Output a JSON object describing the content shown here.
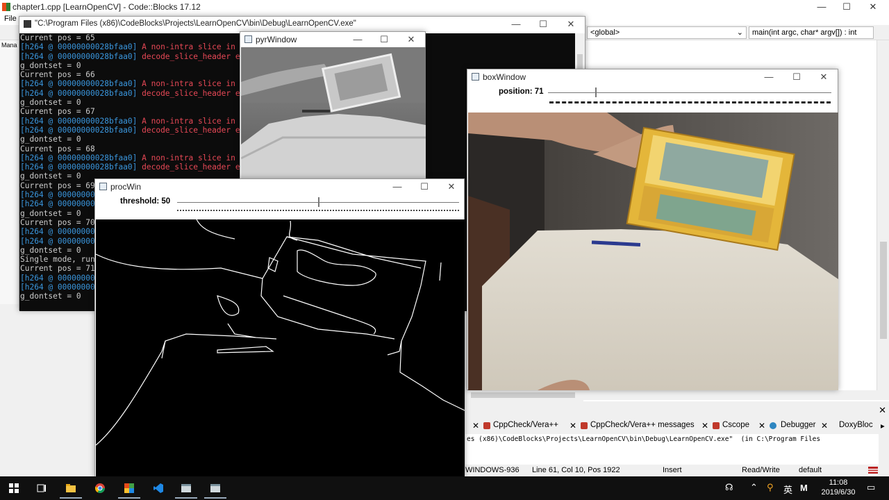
{
  "codeblocks": {
    "title": "chapter1.cpp [LearnOpenCV] - Code::Blocks 17.12",
    "menu_first": "File",
    "scope_combo": "<global>",
    "function_combo": "main(int argc, char* argv[]) : int",
    "left_panel_label": "Mana",
    "log_tabs": [
      {
        "label": "CppCheck/Vera++",
        "icon": "cppcheck-icon"
      },
      {
        "label": "CppCheck/Vera++ messages",
        "icon": "cppcheck-icon"
      },
      {
        "label": "Cscope",
        "icon": "cscope-icon"
      },
      {
        "label": "Debugger",
        "icon": "debugger-icon"
      },
      {
        "label": "DoxyBloc",
        "icon": "doxyblocks-icon"
      }
    ],
    "log_line": "es (x86)\\CodeBlocks\\Projects\\LearnOpenCV\\bin\\Debug\\LearnOpenCV.exe\"  (in C:\\Program Files",
    "status": {
      "encoding": "WINDOWS-936",
      "position": "Line 61, Col 10, Pos 1922",
      "mode": "Insert",
      "access": "Read/Write",
      "profile": "default"
    }
  },
  "console": {
    "title": "\"C:\\Program Files (x86)\\CodeBlocks\\Projects\\LearnOpenCV\\bin\\Debug\\LearnOpenCV.exe\"",
    "lines": [
      {
        "parts": [
          {
            "c": "w",
            "t": "Current pos = 65"
          }
        ]
      },
      {
        "parts": [
          {
            "c": "t",
            "t": "[h264 @ 00000000028bfaa0] "
          },
          {
            "c": "r",
            "t": "A non-intra slice in an IDR NAL unit."
          }
        ]
      },
      {
        "parts": [
          {
            "c": "t",
            "t": "[h264 @ 00000000028bfaa0] "
          },
          {
            "c": "r",
            "t": "decode_slice_header error"
          }
        ]
      },
      {
        "parts": [
          {
            "c": "w",
            "t": "g_dontset = 0"
          }
        ]
      },
      {
        "parts": [
          {
            "c": "w",
            "t": "Current pos = 66"
          }
        ]
      },
      {
        "parts": [
          {
            "c": "t",
            "t": "[h264 @ 00000000028bfaa0] "
          },
          {
            "c": "r",
            "t": "A non-intra slice in an IDR NAL unit."
          }
        ]
      },
      {
        "parts": [
          {
            "c": "t",
            "t": "[h264 @ 00000000028bfaa0] "
          },
          {
            "c": "r",
            "t": "decode_slice_header error"
          }
        ]
      },
      {
        "parts": [
          {
            "c": "w",
            "t": "g_dontset = 0"
          }
        ]
      },
      {
        "parts": [
          {
            "c": "w",
            "t": "Current pos = 67"
          }
        ]
      },
      {
        "parts": [
          {
            "c": "t",
            "t": "[h264 @ 00000000028bfaa0] "
          },
          {
            "c": "r",
            "t": "A non-intra slice in an IDR NAL unit."
          }
        ]
      },
      {
        "parts": [
          {
            "c": "t",
            "t": "[h264 @ 00000000028bfaa0] "
          },
          {
            "c": "r",
            "t": "decode_slice_header error"
          }
        ]
      },
      {
        "parts": [
          {
            "c": "w",
            "t": "g_dontset = 0"
          }
        ]
      },
      {
        "parts": [
          {
            "c": "w",
            "t": "Current pos = 68"
          }
        ]
      },
      {
        "parts": [
          {
            "c": "t",
            "t": "[h264 @ 00000000028bfaa0] "
          },
          {
            "c": "r",
            "t": "A non-intra slice in an IDR NAL unit."
          }
        ]
      },
      {
        "parts": [
          {
            "c": "t",
            "t": "[h264 @ 00000000028bfaa0] "
          },
          {
            "c": "r",
            "t": "decode_slice_header error"
          }
        ]
      },
      {
        "parts": [
          {
            "c": "w",
            "t": "g_dontset = 0"
          }
        ]
      },
      {
        "parts": [
          {
            "c": "w",
            "t": "Current pos = 69"
          }
        ]
      },
      {
        "parts": [
          {
            "c": "t",
            "t": "[h264 @ 00000000028bfaa0] "
          }
        ]
      },
      {
        "parts": [
          {
            "c": "t",
            "t": "[h264 @ 00000000028bfaa0] "
          }
        ]
      },
      {
        "parts": [
          {
            "c": "w",
            "t": "g_dontset = 0"
          }
        ]
      },
      {
        "parts": [
          {
            "c": "w",
            "t": "Current pos = 70"
          }
        ]
      },
      {
        "parts": [
          {
            "c": "t",
            "t": "[h264 @ 00000000028bfaa0] "
          }
        ]
      },
      {
        "parts": [
          {
            "c": "t",
            "t": "[h264 @ 00000000028bfaa0] "
          }
        ]
      },
      {
        "parts": [
          {
            "c": "w",
            "t": "g_dontset = 0"
          }
        ]
      },
      {
        "parts": [
          {
            "c": "w",
            "t": "Single mode, run"
          }
        ]
      },
      {
        "parts": [
          {
            "c": "w",
            "t": "Current pos = 71"
          }
        ]
      },
      {
        "parts": [
          {
            "c": "t",
            "t": "[h264 @ 00000000028bfaa0] "
          }
        ]
      },
      {
        "parts": [
          {
            "c": "t",
            "t": "[h264 @ 00000000028bfaa0] "
          }
        ]
      },
      {
        "parts": [
          {
            "c": "w",
            "t": "g_dontset = 0"
          }
        ]
      }
    ]
  },
  "pyr_window": {
    "title": "pyrWindow"
  },
  "proc_window": {
    "title": "procWin",
    "trackbar_label": "threshold: 50",
    "trackbar_value": 50,
    "trackbar_max": 100
  },
  "box_window": {
    "title": "boxWindow",
    "trackbar_label": "position: 71",
    "trackbar_value": 71,
    "trackbar_max": 1000
  },
  "window_controls": {
    "minimize": "—",
    "maximize": "☐",
    "close": "✕"
  },
  "taskbar": {
    "apps": [
      "start-icon",
      "task-view-icon",
      "file-explorer-icon",
      "chrome-icon",
      "codeblocks-icon",
      "vscode-icon",
      "app-window-icon",
      "app-window-icon"
    ],
    "tray_ime": "英",
    "tray_m": "M",
    "time": "11:08",
    "date": "2019/6/30"
  },
  "colors": {
    "console_bg": "#0c0c0c",
    "console_text": "#cccccc",
    "console_teal": "#3a96dd",
    "console_red": "#e74856",
    "taskbar": "#101010"
  }
}
